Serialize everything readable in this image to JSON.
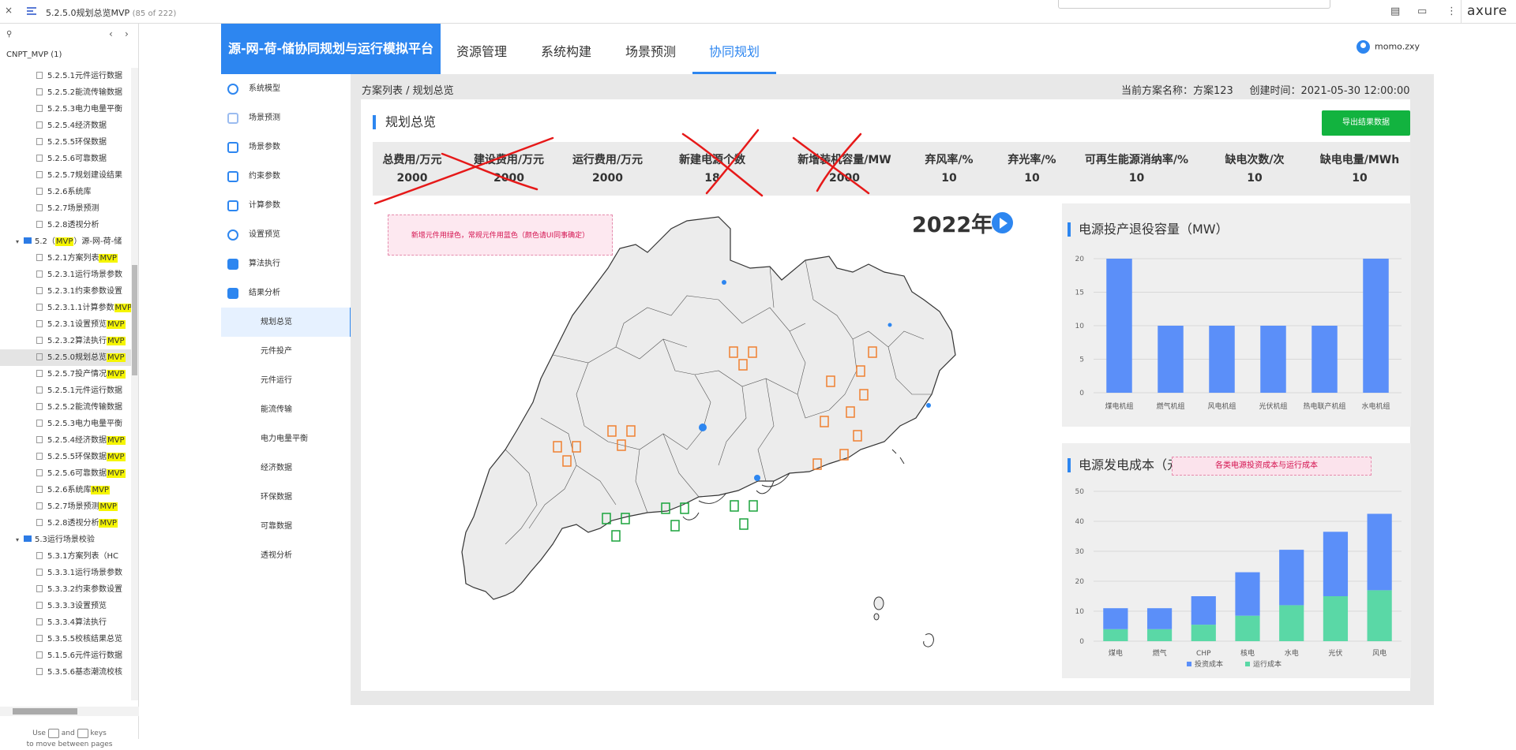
{
  "browser": {
    "close_glyph": "×",
    "page_title": "5.2.5.0规划总览MVP",
    "page_count": "(85 of 222)",
    "product": "axure"
  },
  "sitemap": {
    "project": "CNPT_MVP (1)",
    "items": [
      {
        "indent": 3,
        "type": "page",
        "text": "5.2.5.1元件运行数据",
        "mvp": false
      },
      {
        "indent": 3,
        "type": "page",
        "text": "5.2.5.2能流传输数据",
        "mvp": false
      },
      {
        "indent": 3,
        "type": "page",
        "text": "5.2.5.3电力电量平衡",
        "mvp": false
      },
      {
        "indent": 3,
        "type": "page",
        "text": "5.2.5.4经济数据",
        "mvp": false
      },
      {
        "indent": 3,
        "type": "page",
        "text": "5.2.5.5环保数据",
        "mvp": false
      },
      {
        "indent": 3,
        "type": "page",
        "text": "5.2.5.6可靠数据",
        "mvp": false
      },
      {
        "indent": 3,
        "type": "page",
        "text": "5.2.5.7规划建设结果",
        "mvp": false
      },
      {
        "indent": 3,
        "type": "page",
        "text": "5.2.6系统库",
        "mvp": false
      },
      {
        "indent": 3,
        "type": "page",
        "text": "5.2.7场景预测",
        "mvp": false
      },
      {
        "indent": 3,
        "type": "page",
        "text": "5.2.8透视分析",
        "mvp": false
      },
      {
        "indent": 1,
        "type": "folder",
        "text": "5.2（",
        "mid": "MVP",
        "tail": "）源-网-荷-储",
        "mvp": false
      },
      {
        "indent": 3,
        "type": "page",
        "text": "5.2.1方案列表",
        "mvp": true
      },
      {
        "indent": 3,
        "type": "page",
        "text": "5.2.3.1运行场景参数",
        "mvp": false
      },
      {
        "indent": 3,
        "type": "page",
        "text": "5.2.3.1约束参数设置",
        "mvp": false
      },
      {
        "indent": 3,
        "type": "page",
        "text": "5.2.3.1.1计算参数",
        "mvp": true
      },
      {
        "indent": 3,
        "type": "page",
        "text": "5.2.3.1设置预览",
        "mvp": true
      },
      {
        "indent": 3,
        "type": "page",
        "text": "5.2.3.2算法执行",
        "mvp": true
      },
      {
        "indent": 3,
        "type": "page",
        "text": "5.2.5.0规划总览",
        "mvp": true,
        "selected": true
      },
      {
        "indent": 3,
        "type": "page",
        "text": "5.2.5.7投产情况",
        "mvp": true
      },
      {
        "indent": 3,
        "type": "page",
        "text": "5.2.5.1元件运行数据",
        "mvp": false
      },
      {
        "indent": 3,
        "type": "page",
        "text": "5.2.5.2能流传输数据",
        "mvp": false
      },
      {
        "indent": 3,
        "type": "page",
        "text": "5.2.5.3电力电量平衡",
        "mvp": false
      },
      {
        "indent": 3,
        "type": "page",
        "text": "5.2.5.4经济数据",
        "mvp": true
      },
      {
        "indent": 3,
        "type": "page",
        "text": "5.2.5.5环保数据",
        "mvp": true
      },
      {
        "indent": 3,
        "type": "page",
        "text": "5.2.5.6可靠数据",
        "mvp": true
      },
      {
        "indent": 3,
        "type": "page",
        "text": "5.2.6系统库",
        "mvp": true
      },
      {
        "indent": 3,
        "type": "page",
        "text": "5.2.7场景预测",
        "mvp": true
      },
      {
        "indent": 3,
        "type": "page",
        "text": "5.2.8透视分析",
        "mvp": true
      },
      {
        "indent": 1,
        "type": "folder",
        "text": "5.3运行场景校验",
        "mvp": false
      },
      {
        "indent": 3,
        "type": "page",
        "text": "5.3.1方案列表（HC",
        "mvp": false
      },
      {
        "indent": 3,
        "type": "page",
        "text": "5.3.3.1运行场景参数",
        "mvp": false
      },
      {
        "indent": 3,
        "type": "page",
        "text": "5.3.3.2约束参数设置",
        "mvp": false
      },
      {
        "indent": 3,
        "type": "page",
        "text": "5.3.3.3设置预览",
        "mvp": false
      },
      {
        "indent": 3,
        "type": "page",
        "text": "5.3.3.4算法执行",
        "mvp": false
      },
      {
        "indent": 3,
        "type": "page",
        "text": "5.3.5.5校核结果总览",
        "mvp": false
      },
      {
        "indent": 3,
        "type": "page",
        "text": "5.1.5.6元件运行数据",
        "mvp": false
      },
      {
        "indent": 3,
        "type": "page",
        "text": "5.3.5.6基态潮流校核",
        "mvp": false
      }
    ],
    "hint_use": "Use",
    "hint_and": "and",
    "hint_keys": "keys",
    "hint_line2": "to move between pages"
  },
  "header": {
    "brand": "源-网-荷-储协同规划与运行模拟平台",
    "tabs": [
      "资源管理",
      "系统构建",
      "场景预测",
      "协同规划"
    ],
    "active_tab": 3,
    "user": "momo.zxy"
  },
  "sidenav": [
    {
      "label": "系统模型",
      "icon": "globe-icon",
      "sub": false
    },
    {
      "label": "场景预测",
      "icon": "chart-icon",
      "sub": false
    },
    {
      "label": "场景参数",
      "icon": "calendar-icon",
      "sub": false
    },
    {
      "label": "约束参数",
      "icon": "gear-icon",
      "sub": false
    },
    {
      "label": "计算参数",
      "icon": "grid-icon",
      "sub": false
    },
    {
      "label": "设置预览",
      "icon": "pie-icon",
      "sub": false
    },
    {
      "label": "算法执行",
      "icon": "close-box-icon",
      "sub": false
    },
    {
      "label": "结果分析",
      "icon": "document-icon",
      "sub": false
    },
    {
      "label": "规划总览",
      "sub": true,
      "active": true
    },
    {
      "label": "元件投产",
      "sub": true
    },
    {
      "label": "元件运行",
      "sub": true
    },
    {
      "label": "能流传输",
      "sub": true
    },
    {
      "label": "电力电量平衡",
      "sub": true
    },
    {
      "label": "经济数据",
      "sub": true
    },
    {
      "label": "环保数据",
      "sub": true
    },
    {
      "label": "可靠数据",
      "sub": true
    },
    {
      "label": "透视分析",
      "sub": true
    }
  ],
  "page": {
    "breadcrumb": "方案列表 / 规划总览",
    "scheme_label": "当前方案名称：方案123",
    "created_label": "创建时间：2021-05-30 12:00:00",
    "title": "规划总览",
    "export_button": "导出结果数据",
    "stats": [
      {
        "label": "总费用/万元",
        "value": "2000"
      },
      {
        "label": "建设费用/万元",
        "value": "2000"
      },
      {
        "label": "运行费用/万元",
        "value": "2000"
      },
      {
        "label": "新建电源个数",
        "value": "18"
      },
      {
        "label": "新增装机容量/MW",
        "value": "2000"
      },
      {
        "label": "弃风率/%",
        "value": "10"
      },
      {
        "label": "弃光率/%",
        "value": "10"
      },
      {
        "label": "可再生能源消纳率/%",
        "value": "10"
      },
      {
        "label": "缺电次数/次",
        "value": "10"
      },
      {
        "label": "缺电电量/MWh",
        "value": "10"
      }
    ],
    "map_note": "新增元件用绿色，常规元件用蓝色（颜色请UI同事确定）",
    "year": "2022年",
    "chart_note": "各类电源投资成本与运行成本"
  },
  "colors": {
    "accent": "#2d86f0",
    "export": "#12b33f",
    "bar": "#5b8ff9",
    "bar2": "#5ad8a6",
    "orange_marker": "#f08030",
    "green_marker": "#1aa33c",
    "red_annotation": "#e61919"
  },
  "chart_data": [
    {
      "type": "bar",
      "title": "电源投产退役容量（MW）",
      "categories": [
        "煤电机组",
        "燃气机组",
        "风电机组",
        "光伏机组",
        "热电联产机组",
        "水电机组"
      ],
      "values": [
        20,
        10,
        10,
        10,
        10,
        20
      ],
      "ylim": [
        0,
        20
      ],
      "yticks": [
        0,
        5,
        10,
        15,
        20
      ],
      "grid": true
    },
    {
      "type": "bar",
      "stacked": true,
      "title": "电源发电成本（元/kWh）",
      "categories": [
        "煤电",
        "燃气",
        "CHP",
        "核电",
        "水电",
        "光伏",
        "风电"
      ],
      "series": [
        {
          "name": "投资成本",
          "values": [
            7,
            7,
            9.5,
            14.5,
            18.5,
            21.5,
            25.5
          ]
        },
        {
          "name": "运行成本",
          "values": [
            4,
            4,
            5.5,
            8.5,
            12,
            15,
            17
          ]
        }
      ],
      "ylim": [
        0,
        50
      ],
      "yticks": [
        0,
        10,
        20,
        30,
        40,
        50
      ],
      "legend": "bottom",
      "grid": true
    }
  ]
}
